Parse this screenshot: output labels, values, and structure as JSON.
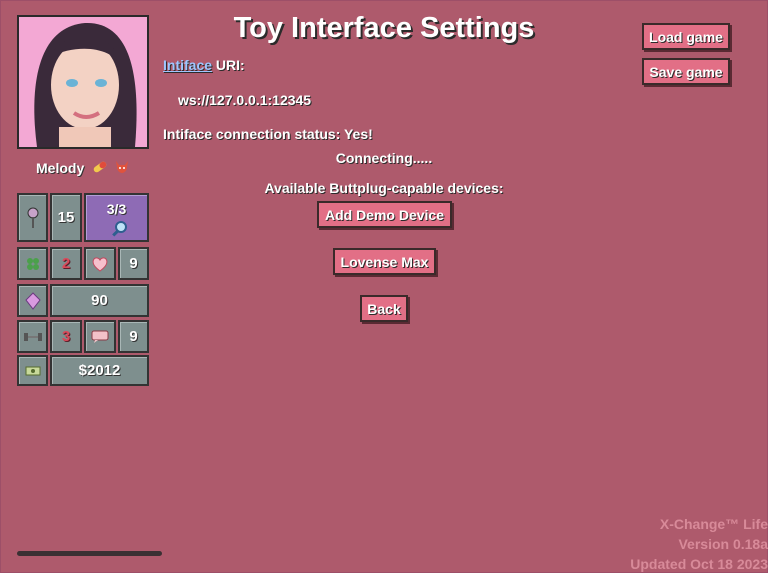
{
  "page": {
    "title": "Toy Interface Settings"
  },
  "character": {
    "name": "Melody",
    "icons": [
      "pill-icon",
      "demon-icon"
    ]
  },
  "stats": {
    "lust_value": "15",
    "uses": "3/3",
    "luck_value": "2",
    "heart_value": "9",
    "crystal_value": "90",
    "strength_value": "3",
    "speech_value": "9",
    "money": "$2012"
  },
  "intiface": {
    "link_text": "Intiface",
    "uri_label": " URI:",
    "uri_value": "ws://127.0.0.1:12345",
    "status_text": "Intiface connection status: Yes!",
    "connecting_text": "Connecting.....",
    "devices_heading": "Available Buttplug-capable devices:"
  },
  "buttons": {
    "add_demo": "Add Demo Device",
    "lovense": "Lovense Max",
    "back": "Back",
    "load_game": "Load game",
    "save_game": "Save game"
  },
  "footer": {
    "line1": "X-Change™ Life",
    "line2": "Version 0.18a",
    "line3": "Updated Oct 18 2023"
  },
  "colors": {
    "background": "#ae5a6c",
    "button": "#e26f86",
    "stat_box": "#7e8f8e",
    "link": "#9fc6ff"
  }
}
